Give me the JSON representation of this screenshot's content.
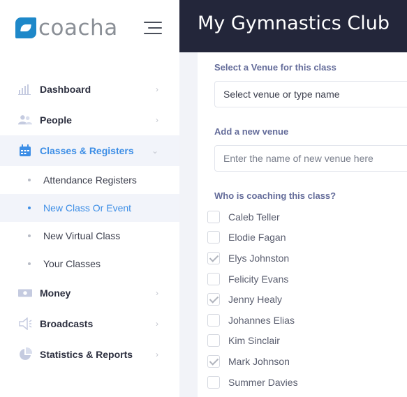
{
  "brand": {
    "name": "coacha"
  },
  "header": {
    "title": "My Gymnastics Club"
  },
  "sidebar": {
    "items": [
      {
        "label": "Dashboard",
        "icon": "bar-chart-icon"
      },
      {
        "label": "People",
        "icon": "people-icon"
      },
      {
        "label": "Classes & Registers",
        "icon": "calendar-icon",
        "active": true,
        "expanded": true,
        "subitems": [
          {
            "label": "Attendance Registers"
          },
          {
            "label": "New Class Or Event",
            "active": true
          },
          {
            "label": "New Virtual Class"
          },
          {
            "label": "Your Classes"
          }
        ]
      },
      {
        "label": "Money",
        "icon": "money-icon"
      },
      {
        "label": "Broadcasts",
        "icon": "megaphone-icon"
      },
      {
        "label": "Statistics & Reports",
        "icon": "pie-chart-icon"
      }
    ]
  },
  "form": {
    "venue_label": "Select a Venue for this class",
    "venue_value": "Select venue or type name",
    "new_venue_label": "Add a new venue",
    "new_venue_placeholder": "Enter the name of new venue here",
    "coaches_label": "Who is coaching this class?",
    "coaches": [
      {
        "name": "Caleb Teller",
        "checked": false
      },
      {
        "name": "Elodie Fagan",
        "checked": false
      },
      {
        "name": "Elys Johnston",
        "checked": true
      },
      {
        "name": "Felicity Evans",
        "checked": false
      },
      {
        "name": "Jenny Healy",
        "checked": true
      },
      {
        "name": "Johannes Elias",
        "checked": false
      },
      {
        "name": "Kim Sinclair",
        "checked": false
      },
      {
        "name": "Mark Johnson",
        "checked": true
      },
      {
        "name": "Summer Davies",
        "checked": false
      }
    ]
  },
  "colors": {
    "accent": "#3d8ee6",
    "header_bg": "#23263a",
    "logo": "#1e88c9"
  }
}
